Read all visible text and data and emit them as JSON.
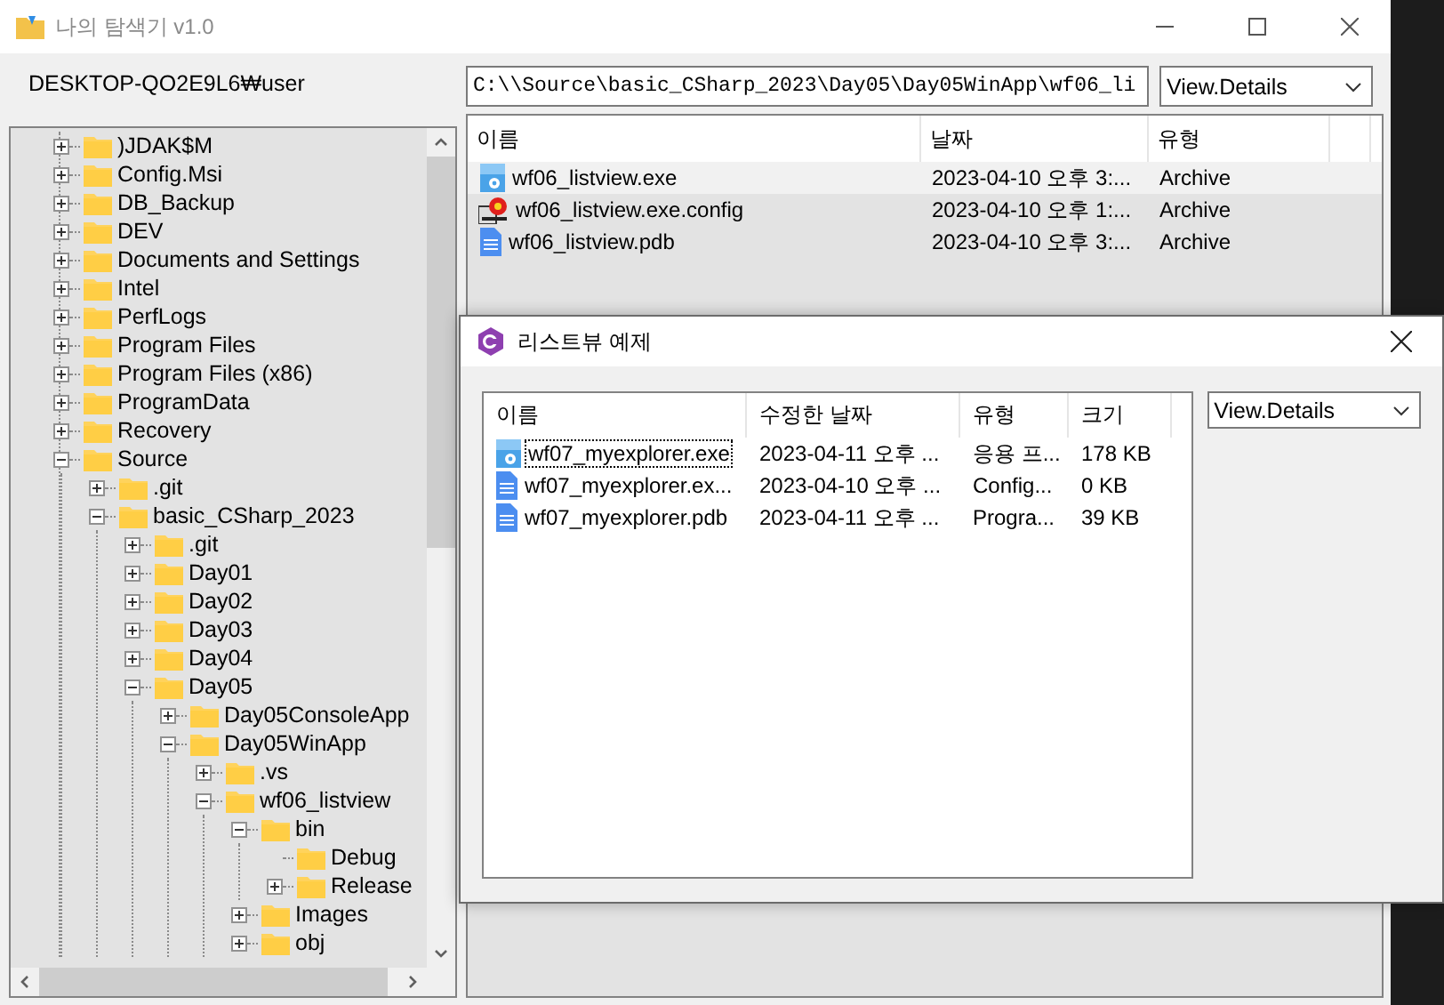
{
  "main_window": {
    "title": "나의 탐색기 v1.0",
    "active": false,
    "user_label": "DESKTOP-QO2E9L6₩user",
    "address": "C:\\\\Source\\basic_CSharp_2023\\Day05\\Day05WinApp\\wf06_li",
    "view_select": "View.Details",
    "tree": [
      {
        "label": ")JDAK$M",
        "expandable": true,
        "expanded": false
      },
      {
        "label": "Config.Msi",
        "expandable": true,
        "expanded": false
      },
      {
        "label": "DB_Backup",
        "expandable": true,
        "expanded": false
      },
      {
        "label": "DEV",
        "expandable": true,
        "expanded": false
      },
      {
        "label": "Documents and Settings",
        "expandable": true,
        "expanded": false
      },
      {
        "label": "Intel",
        "expandable": true,
        "expanded": false
      },
      {
        "label": "PerfLogs",
        "expandable": true,
        "expanded": false
      },
      {
        "label": "Program Files",
        "expandable": true,
        "expanded": false
      },
      {
        "label": "Program Files (x86)",
        "expandable": true,
        "expanded": false
      },
      {
        "label": "ProgramData",
        "expandable": true,
        "expanded": false
      },
      {
        "label": "Recovery",
        "expandable": true,
        "expanded": false
      },
      {
        "label": "Source",
        "expandable": true,
        "expanded": true,
        "children": [
          {
            "label": ".git",
            "expandable": true,
            "expanded": false
          },
          {
            "label": "basic_CSharp_2023",
            "expandable": true,
            "expanded": true,
            "children": [
              {
                "label": ".git",
                "expandable": true,
                "expanded": false
              },
              {
                "label": "Day01",
                "expandable": true,
                "expanded": false
              },
              {
                "label": "Day02",
                "expandable": true,
                "expanded": false
              },
              {
                "label": "Day03",
                "expandable": true,
                "expanded": false
              },
              {
                "label": "Day04",
                "expandable": true,
                "expanded": false
              },
              {
                "label": "Day05",
                "expandable": true,
                "expanded": true,
                "children": [
                  {
                    "label": "Day05ConsoleApp",
                    "expandable": true,
                    "expanded": false
                  },
                  {
                    "label": "Day05WinApp",
                    "expandable": true,
                    "expanded": true,
                    "children": [
                      {
                        "label": ".vs",
                        "expandable": true,
                        "expanded": false
                      },
                      {
                        "label": "wf06_listview",
                        "expandable": true,
                        "expanded": true,
                        "children": [
                          {
                            "label": "bin",
                            "expandable": true,
                            "expanded": true,
                            "children": [
                              {
                                "label": "Debug",
                                "expandable": false,
                                "expanded": false
                              },
                              {
                                "label": "Release",
                                "expandable": true,
                                "expanded": false
                              }
                            ]
                          },
                          {
                            "label": "Images",
                            "expandable": true,
                            "expanded": false
                          },
                          {
                            "label": "obj",
                            "expandable": true,
                            "expanded": false
                          }
                        ]
                      }
                    ]
                  }
                ]
              }
            ]
          }
        ]
      }
    ],
    "list_columns": [
      "이름",
      "날짜",
      "유형"
    ],
    "list_rows": [
      {
        "kind": "exe",
        "name": "wf06_listview.exe",
        "date": "2023-04-10 오후 3:...",
        "type": "Archive",
        "highlighted": true
      },
      {
        "kind": "config",
        "name": "wf06_listview.exe.config",
        "date": "2023-04-10 오후 1:...",
        "type": "Archive",
        "highlighted": false
      },
      {
        "kind": "document",
        "name": "wf06_listview.pdb",
        "date": "2023-04-10 오후 3:...",
        "type": "Archive",
        "highlighted": false
      }
    ]
  },
  "dialog": {
    "title": "리스트뷰 예제",
    "view_select": "View.Details",
    "list_columns": [
      "이름",
      "수정한 날짜",
      "유형",
      "크기"
    ],
    "list_rows": [
      {
        "kind": "exe",
        "name": "wf07_myexplorer.exe",
        "date": "2023-04-11 오후 ...",
        "type": "응용 프...",
        "size": "178 KB",
        "focused": true
      },
      {
        "kind": "document",
        "name": "wf07_myexplorer.ex...",
        "date": "2023-04-10 오후 ...",
        "type": "Config...",
        "size": "0 KB",
        "focused": false
      },
      {
        "kind": "document",
        "name": "wf07_myexplorer.pdb",
        "date": "2023-04-11 오후 ...",
        "type": "Progra...",
        "size": "39 KB",
        "focused": false
      }
    ]
  }
}
